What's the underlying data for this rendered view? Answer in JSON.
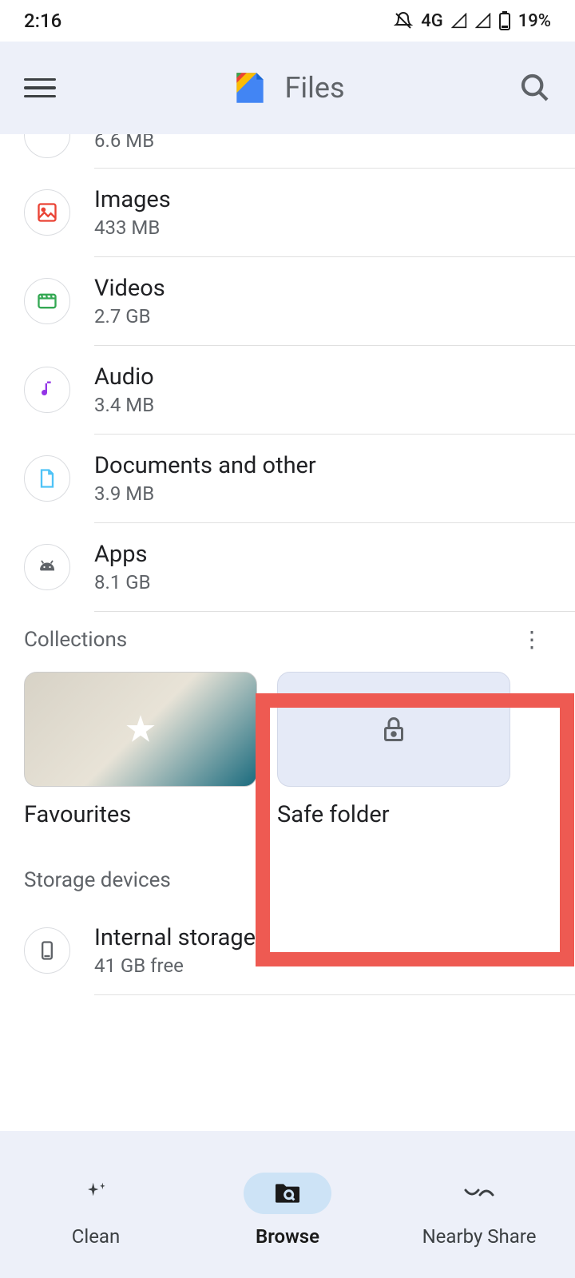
{
  "status": {
    "time": "2:16",
    "network": "4G",
    "battery": "19%"
  },
  "header": {
    "title": "Files"
  },
  "categories": [
    {
      "key": "downloads_partial",
      "name": "",
      "size": "6.6 MB"
    },
    {
      "key": "images",
      "name": "Images",
      "size": "433 MB"
    },
    {
      "key": "videos",
      "name": "Videos",
      "size": "2.7 GB"
    },
    {
      "key": "audio",
      "name": "Audio",
      "size": "3.4 MB"
    },
    {
      "key": "documents",
      "name": "Documents and other",
      "size": "3.9 MB"
    },
    {
      "key": "apps",
      "name": "Apps",
      "size": "8.1 GB"
    }
  ],
  "sections": {
    "collections": {
      "title": "Collections"
    },
    "storage": {
      "title": "Storage devices"
    }
  },
  "collections": {
    "favourites": "Favourites",
    "safeFolder": "Safe folder"
  },
  "storage": {
    "internal": {
      "name": "Internal storage",
      "free": "41 GB free"
    }
  },
  "nav": {
    "clean": "Clean",
    "browse": "Browse",
    "share": "Nearby Share"
  }
}
